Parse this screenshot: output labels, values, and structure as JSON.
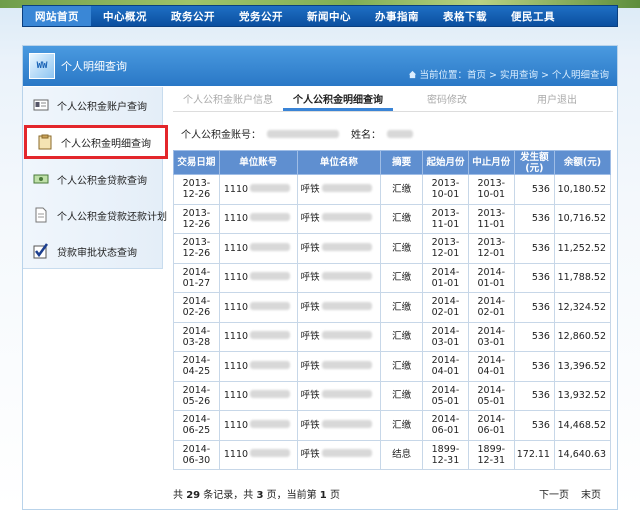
{
  "nav": {
    "items": [
      {
        "label": "网站首页",
        "active": true
      },
      {
        "label": "中心概况"
      },
      {
        "label": "政务公开"
      },
      {
        "label": "党务公开"
      },
      {
        "label": "新闻中心"
      },
      {
        "label": "办事指南"
      },
      {
        "label": "表格下载"
      },
      {
        "label": "便民工具"
      }
    ]
  },
  "panel": {
    "logo_text": "WW",
    "title": "个人明细查询",
    "breadcrumb": "当前位置：首页 > 实用查询 > 个人明细查询"
  },
  "sidebar": {
    "items": [
      {
        "label": "个人公积金账户查询",
        "icon": "id-card-icon"
      },
      {
        "label": "个人公积金明细查询",
        "icon": "clipboard-icon"
      },
      {
        "label": "个人公积金贷款查询",
        "icon": "money-icon"
      },
      {
        "label": "个人公积金贷款还款计划",
        "icon": "document-icon"
      },
      {
        "label": "贷款审批状态查询",
        "icon": "checkbox-icon"
      }
    ]
  },
  "tabs": [
    {
      "label": "个人公积金账户信息"
    },
    {
      "label": "个人公积金明细查询",
      "active": true
    },
    {
      "label": "密码修改"
    },
    {
      "label": "用户退出"
    }
  ],
  "account": {
    "account_label": "个人公积金账号：",
    "name_label": "姓名："
  },
  "table": {
    "headers": [
      "交易日期",
      "单位账号",
      "单位名称",
      "摘要",
      "起始月份",
      "中止月份",
      "发生额\n(元)",
      "余额(元)"
    ],
    "rows": [
      {
        "date": "2013-12-26",
        "acct": "1110",
        "unit": "呼铁",
        "summary": "汇缴",
        "start": "2013-10-01",
        "end": "2013-10-01",
        "amount": "536",
        "balance": "10,180.52"
      },
      {
        "date": "2013-12-26",
        "acct": "1110",
        "unit": "呼铁",
        "summary": "汇缴",
        "start": "2013-11-01",
        "end": "2013-11-01",
        "amount": "536",
        "balance": "10,716.52"
      },
      {
        "date": "2013-12-26",
        "acct": "1110",
        "unit": "呼铁",
        "summary": "汇缴",
        "start": "2013-12-01",
        "end": "2013-12-01",
        "amount": "536",
        "balance": "11,252.52"
      },
      {
        "date": "2014-01-27",
        "acct": "1110",
        "unit": "呼铁",
        "summary": "汇缴",
        "start": "2014-01-01",
        "end": "2014-01-01",
        "amount": "536",
        "balance": "11,788.52"
      },
      {
        "date": "2014-02-26",
        "acct": "1110",
        "unit": "呼铁",
        "summary": "汇缴",
        "start": "2014-02-01",
        "end": "2014-02-01",
        "amount": "536",
        "balance": "12,324.52"
      },
      {
        "date": "2014-03-28",
        "acct": "1110",
        "unit": "呼铁",
        "summary": "汇缴",
        "start": "2014-03-01",
        "end": "2014-03-01",
        "amount": "536",
        "balance": "12,860.52"
      },
      {
        "date": "2014-04-25",
        "acct": "1110",
        "unit": "呼铁",
        "summary": "汇缴",
        "start": "2014-04-01",
        "end": "2014-04-01",
        "amount": "536",
        "balance": "13,396.52"
      },
      {
        "date": "2014-05-26",
        "acct": "1110",
        "unit": "呼铁",
        "summary": "汇缴",
        "start": "2014-05-01",
        "end": "2014-05-01",
        "amount": "536",
        "balance": "13,932.52"
      },
      {
        "date": "2014-06-25",
        "acct": "1110",
        "unit": "呼铁",
        "summary": "汇缴",
        "start": "2014-06-01",
        "end": "2014-06-01",
        "amount": "536",
        "balance": "14,468.52"
      },
      {
        "date": "2014-06-30",
        "acct": "1110",
        "unit": "呼铁",
        "summary": "结息",
        "start": "1899-12-31",
        "end": "1899-12-31",
        "amount": "172.11",
        "balance": "14,640.63"
      }
    ]
  },
  "pager": {
    "t1": "共 ",
    "total": "29",
    "t2": " 条记录，共 ",
    "pages": "3",
    "t3": " 页，当前第 ",
    "current": "1",
    "t4": " 页",
    "next": "下一页",
    "last": "末页"
  },
  "colors": {
    "nav_bg": "#0b4f9f",
    "header_bg": "#2a78c6",
    "table_header_bg": "#5f8fd0",
    "highlight_border": "#e3262b"
  }
}
